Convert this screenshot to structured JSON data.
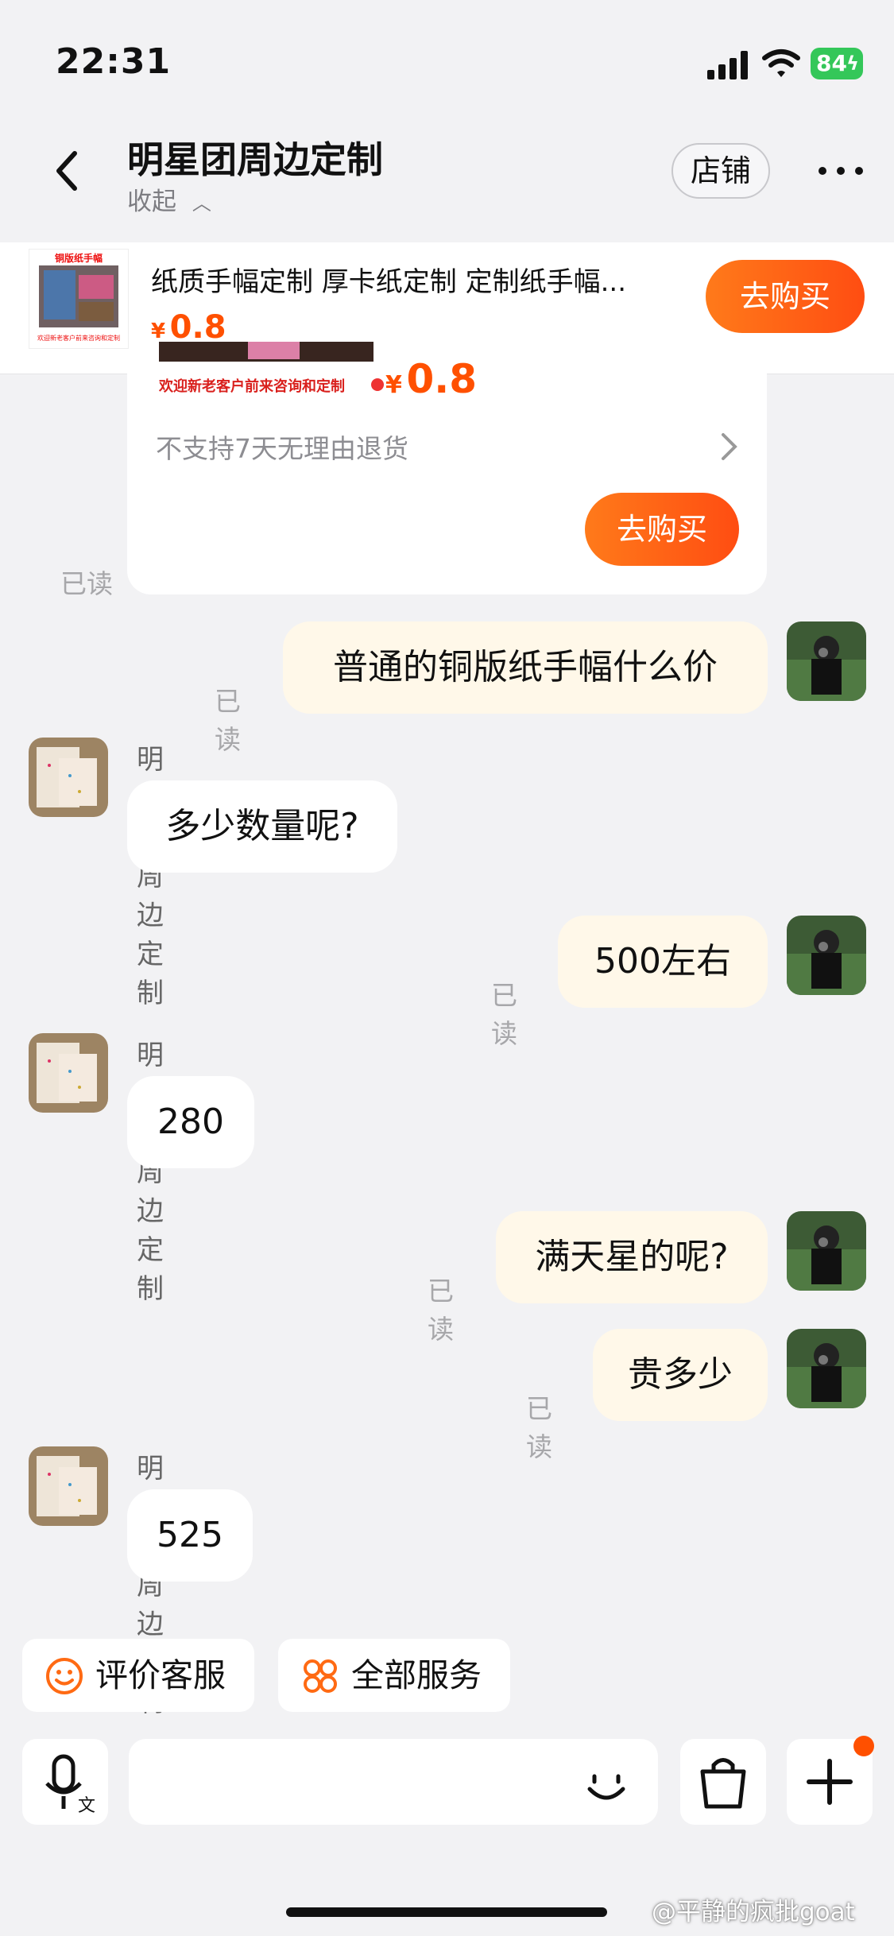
{
  "status_bar": {
    "time": "22:31",
    "battery": "84",
    "accent_green": "#34c759"
  },
  "header": {
    "title": "明星团周边定制",
    "collapse_label": "收起",
    "store_label": "店铺",
    "back_icon": "chevron-left-icon",
    "more_icon": "more-horizontal-icon"
  },
  "product": {
    "title": "纸质手幅定制 厚卡纸定制 定制纸手幅...",
    "price_symbol": "¥",
    "price_value": "0.8",
    "buy_label": "去购买",
    "thumbnail_caption_top": "铜版纸手幅",
    "thumbnail_caption_bottom": "欢迎新老客户前来咨询和定制",
    "accent_color": "#ff5000"
  },
  "product_card": {
    "banner_text": "欢迎新老客户前来咨询和定制",
    "price_symbol": "¥",
    "price_value": "0.8",
    "return_note": "不支持7天无理由退货",
    "buy_label": "去购买",
    "read_label": "已读"
  },
  "messages": [
    {
      "sender": "self",
      "text": "普通的铜版纸手幅什么价",
      "read_label": "已读"
    },
    {
      "sender": "shop",
      "sender_name": "明星团周边定制",
      "text": "多少数量呢?"
    },
    {
      "sender": "self",
      "text": "500左右",
      "read_label": "已读"
    },
    {
      "sender": "shop",
      "sender_name": "明星团周边定制",
      "text": "280"
    },
    {
      "sender": "self",
      "text": "满天星的呢?",
      "read_label": "已读"
    },
    {
      "sender": "self",
      "text": "贵多少",
      "read_label": "已读"
    },
    {
      "sender": "shop",
      "sender_name": "明星团周边定制",
      "text": "525"
    }
  ],
  "quick_actions": {
    "rate_service": "评价客服",
    "all_services": "全部服务",
    "rate_icon": "smile-icon",
    "services_icon": "grid-icon"
  },
  "input_bar": {
    "voice_icon": "voice-translate-icon",
    "emoji_icon": "emoji-icon",
    "bag_icon": "shopping-bag-icon",
    "plus_icon": "plus-icon",
    "input_value": ""
  },
  "watermark": {
    "text": "@平静的疯批goat"
  }
}
